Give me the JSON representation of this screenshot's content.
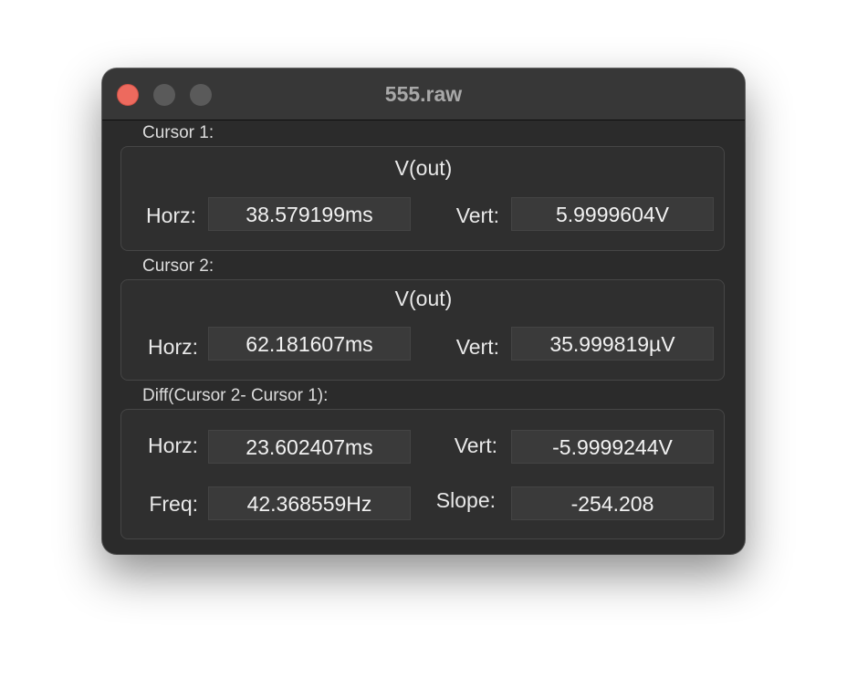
{
  "window": {
    "title": "555.raw"
  },
  "cursor1": {
    "label": "Cursor 1:",
    "trace": "V(out)",
    "horz_label": "Horz:",
    "horz_value": "38.579199ms",
    "vert_label": "Vert:",
    "vert_value": "5.9999604V"
  },
  "cursor2": {
    "label": "Cursor 2:",
    "trace": "V(out)",
    "horz_label": "Horz:",
    "horz_value": "62.181607ms",
    "vert_label": "Vert:",
    "vert_value": "35.999819µV"
  },
  "diff": {
    "label": "Diff(Cursor 2- Cursor 1):",
    "horz_label": "Horz:",
    "horz_value": "23.602407ms",
    "vert_label": "Vert:",
    "vert_value": "-5.9999244V",
    "freq_label": "Freq:",
    "freq_value": "42.368559Hz",
    "slope_label": "Slope:",
    "slope_value": "-254.208"
  },
  "colors": {
    "close_button": "#ed6a5e",
    "inactive_button": "#5a5a5a",
    "window_background": "#2b2b2b"
  }
}
